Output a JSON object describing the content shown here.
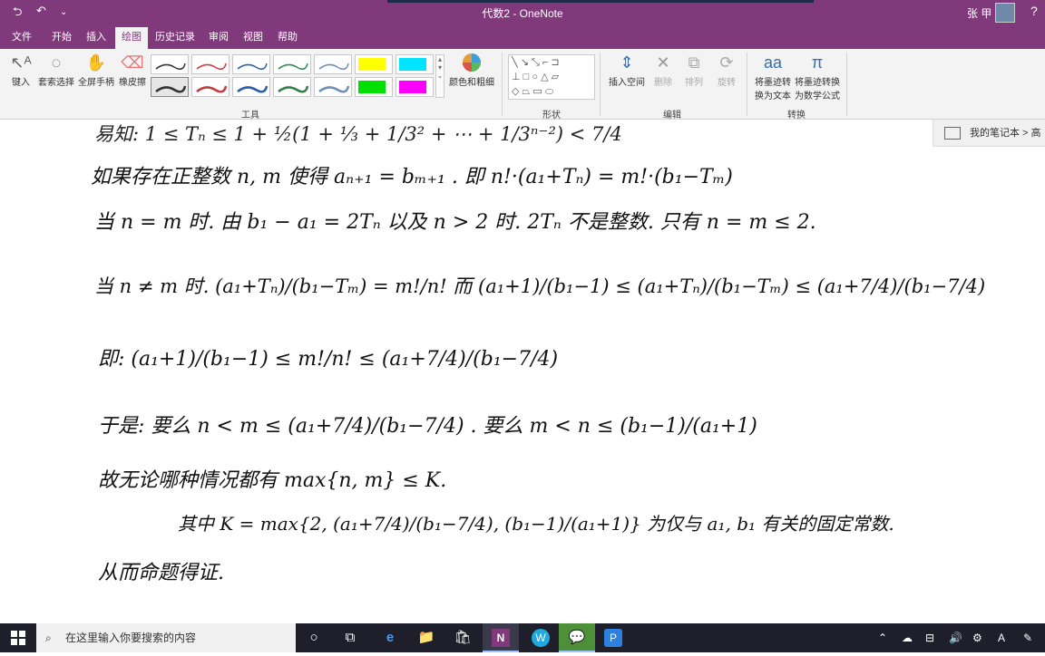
{
  "window": {
    "title": "代数2 - OneNote",
    "user_name": "张 甲",
    "qat": [
      "⮌",
      "↶",
      "⌄"
    ],
    "controls": [
      "?",
      "—",
      "❐",
      "✕"
    ]
  },
  "tabs": [
    {
      "label": "文件"
    },
    {
      "label": "开始"
    },
    {
      "label": "插入"
    },
    {
      "label": "绘图"
    },
    {
      "label": "历史记录"
    },
    {
      "label": "审阅"
    },
    {
      "label": "视图"
    },
    {
      "label": "帮助"
    }
  ],
  "ribbon": {
    "tools": {
      "type_label": "键入",
      "lasso_label": "套索选择",
      "pan_label": "全屏手柄",
      "eraser_label": "橡皮擦",
      "group_label": "工具",
      "color_thickness_label": "颜色和粗细"
    },
    "pen_colors": [
      "#333333",
      "#d23a3a",
      "#2f5fa8",
      "#2f8a4f",
      "#6a8fbf",
      "#333333",
      "#c33b3b",
      "#2b5aa8",
      "#2f7f4a",
      "#6f8fb8"
    ],
    "highlighter_colors": [
      "#ffff00",
      "#00e5ff",
      "#00e000",
      "#ff00ff"
    ],
    "shapes": {
      "group_label": "形状"
    },
    "edit": {
      "insert_space_label": "插入空间",
      "delete_label": "删除",
      "arrange_label": "排列",
      "rotate_label": "旋转",
      "group_label": "编辑"
    },
    "convert": {
      "ink_to_text_label_1": "将墨迹转",
      "ink_to_text_label_2": "换为文本",
      "ink_to_math_label_1": "将墨迹转换",
      "ink_to_math_label_2": "为数学公式",
      "group_label": "转换"
    }
  },
  "notebook_panel": {
    "label": "我的笔记本 > 高"
  },
  "page": {
    "lines": [
      "易知: 1 ≤ Tₙ ≤ 1 + ½(1 + ⅓ + 1/3² + ⋯ + 1/3ⁿ⁻²) < 7/4",
      "如果存在正整数 n, m 使得 aₙ₊₁ = bₘ₊₁ . 即 n!·(a₁+Tₙ) = m!·(b₁−Tₘ)",
      "当 n = m 时. 由 b₁ − a₁ = 2Tₙ 以及 n > 2 时. 2Tₙ 不是整数. 只有 n = m ≤ 2.",
      "当 n ≠ m 时.  (a₁+Tₙ)/(b₁−Tₘ) = m!/n!   而 (a₁+1)/(b₁−1) ≤ (a₁+Tₙ)/(b₁−Tₘ) ≤ (a₁+7/4)/(b₁−7/4)",
      "即:  (a₁+1)/(b₁−1) ≤ m!/n! ≤ (a₁+7/4)/(b₁−7/4)",
      "于是: 要么  n < m ≤ (a₁+7/4)/(b₁−7/4) . 要么 m < n ≤ (b₁−1)/(a₁+1)",
      "故无论哪种情况都有  max{n, m} ≤ K.",
      "其中 K = max{2, (a₁+7/4)/(b₁−7/4), (b₁−1)/(a₁+1)} 为仅与 a₁, b₁ 有关的固定常数.",
      "从而命题得证."
    ]
  },
  "taskbar": {
    "search_placeholder": "在这里输入你要搜索的内容",
    "apps": [
      "○",
      "⧉",
      "e",
      "📁",
      "🛍",
      "N",
      "W",
      "💬",
      "P"
    ],
    "tray": [
      "⌃",
      "☁",
      "⊟",
      "🔊",
      "⚙",
      "A",
      "✎"
    ]
  }
}
